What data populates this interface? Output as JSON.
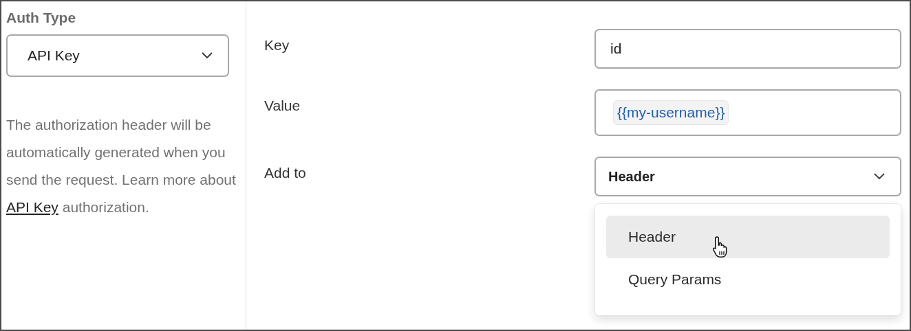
{
  "sidebar": {
    "title": "Auth Type",
    "auth_type": {
      "value": "API Key"
    },
    "description": {
      "before": "The authorization header will be automatically generated when you send the request. Learn more about",
      "link": "API Key",
      "after": "authorization."
    }
  },
  "fields": [
    {
      "label": "Key",
      "kind": "text",
      "value": "id"
    },
    {
      "label": "Value",
      "kind": "variable",
      "value": "{{my-username}}"
    },
    {
      "label": "Add to",
      "kind": "select",
      "value": "Header"
    }
  ],
  "dropdown": {
    "options": [
      {
        "label": "Header",
        "hovered": true
      },
      {
        "label": "Query Params",
        "hovered": false
      }
    ]
  }
}
